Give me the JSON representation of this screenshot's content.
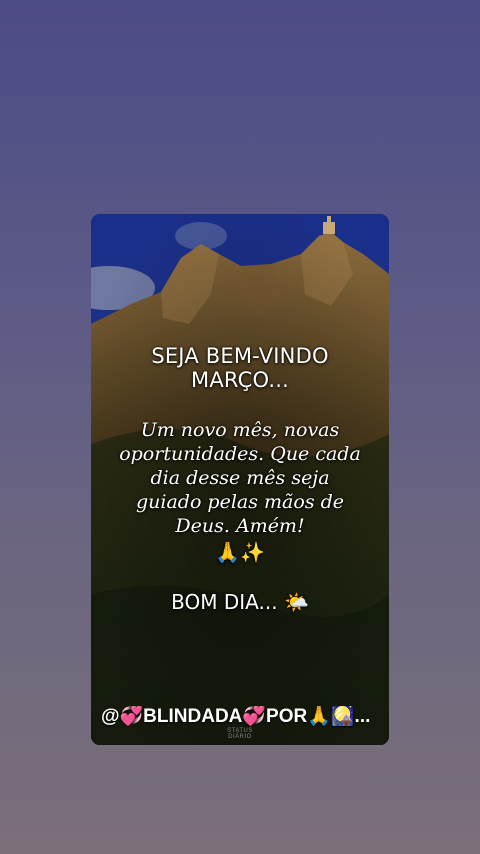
{
  "colors": {
    "background_top": "#4c4c86",
    "background_bottom": "#7a6f79",
    "sky": "#1a2f8a",
    "text": "#ffffff"
  },
  "card": {
    "title_line1": "SEJA BEM-VINDO",
    "title_line2": "MARÇO...",
    "message_lines": [
      "Um novo mês, novas",
      "oportunidades. Que cada",
      "dia desse mês seja",
      "guiado pelas mãos de",
      "Deus. Amém!"
    ],
    "emoji_line": "🙏✨",
    "greeting": "BOM DIA... 🌤️",
    "signature": "@💞BLINDADA💞POR🙏🎑...",
    "watermark_line1": "STATUS",
    "watermark_line2": "DIÁRIO"
  },
  "icons": [
    "praying-hands-icon",
    "sparkles-icon",
    "sun-behind-cloud-icon",
    "heart-icon"
  ]
}
